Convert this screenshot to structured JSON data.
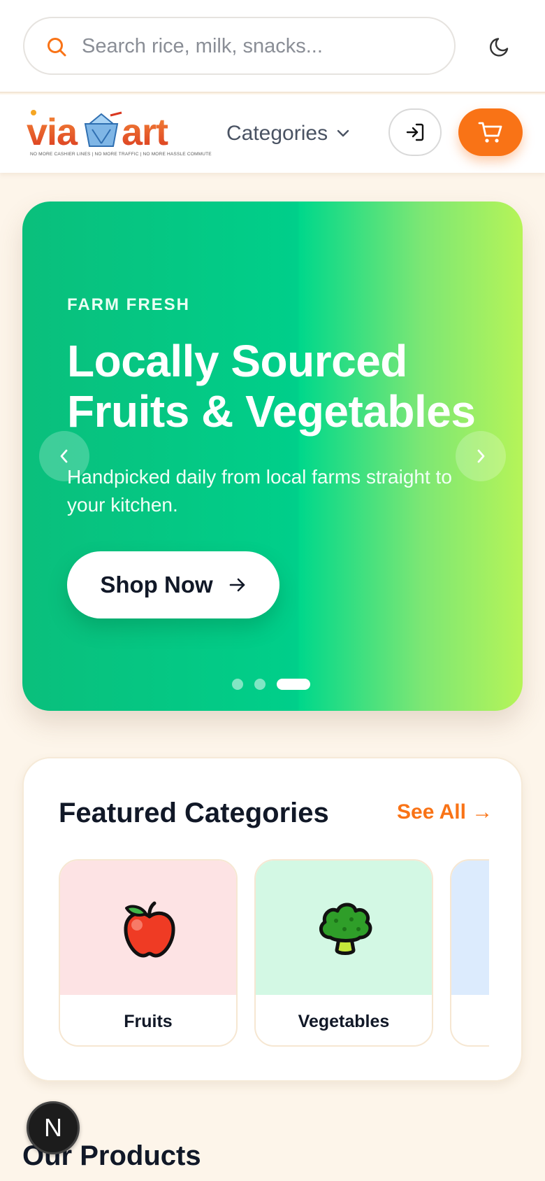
{
  "search": {
    "placeholder": "Search rice, milk, snacks...",
    "value": ""
  },
  "header": {
    "logo_text": "viaMart",
    "logo_tagline": "NO MORE CASHIER LINES | NO MORE TRAFFIC | NO MORE HASSLE COMMUTE",
    "categories_label": "Categories",
    "accent_color": "#f97316"
  },
  "hero": {
    "eyebrow": "FARM FRESH",
    "title": "Locally Sourced Fruits & Vegetables",
    "subtitle": "Handpicked daily from local farms straight to your kitchen.",
    "cta_label": "Shop Now",
    "slide_count": 3,
    "active_slide": 3
  },
  "featured": {
    "title": "Featured Categories",
    "see_all_label": "See All →",
    "categories": [
      {
        "label": "Fruits",
        "icon": "apple-icon",
        "bg": "#fde3e4"
      },
      {
        "label": "Vegetables",
        "icon": "broccoli-icon",
        "bg": "#d3f8e4"
      },
      {
        "label": "",
        "icon": "",
        "bg": "#dcebfd"
      }
    ]
  },
  "products": {
    "title": "Our Products"
  },
  "dev_badge": {
    "letter": "N"
  }
}
